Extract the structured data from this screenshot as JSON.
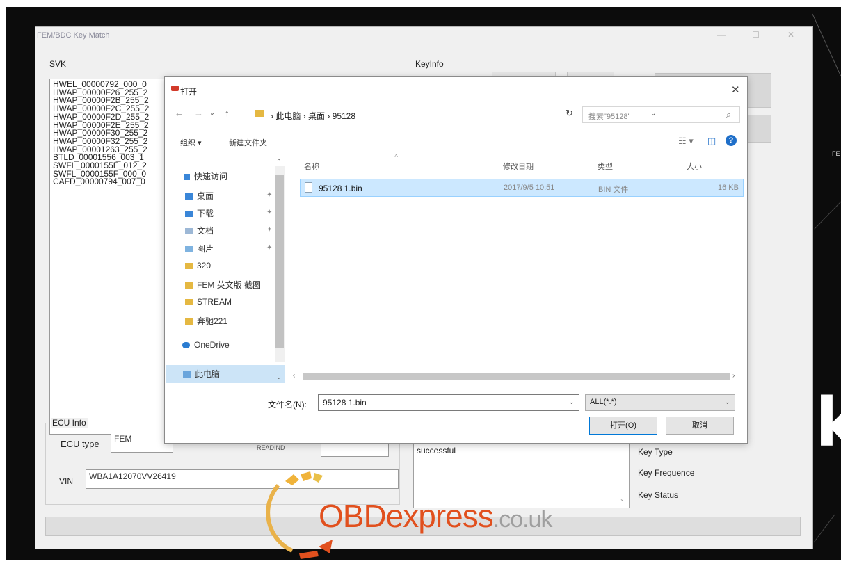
{
  "main_window": {
    "title": "FEM/BDC Key Match",
    "controls": {
      "minimize": "—",
      "maximize": "☐",
      "close": "✕"
    },
    "svk": {
      "label": "SVK",
      "items": [
        "HWEL_00000792_000_0",
        "HWAP_00000F26_255_2",
        "HWAP_00000F2B_255_2",
        "HWAP_00000F2C_255_2",
        "HWAP_00000F2D_255_2",
        "HWAP_00000F2E_255_2",
        "HWAP_00000F30_255_2",
        "HWAP_00000F32_255_2",
        "HWAP_00001263_255_2",
        "BTLD_00001556_003_1",
        "SWFL_0000155E_012_2",
        "SWFL_0000155F_000_0",
        "CAFD_00000794_007_0"
      ]
    },
    "keyinfo_label": "KeyInfo",
    "ecu_info": {
      "label": "ECU Info",
      "ecu_type_label": "ECU type",
      "ecu_type_value": "FEM",
      "partial_label": "READIND",
      "vin_label": "VIN",
      "vin_value": "WBA1A12070VV26419"
    },
    "result_text": "successful",
    "key_labels": [
      "Key Type",
      "Key Frequence",
      "Key Status"
    ]
  },
  "dialog": {
    "title": "打开",
    "close": "✕",
    "nav": {
      "back": "←",
      "forward": "→",
      "down": "⌄",
      "up": "↑"
    },
    "breadcrumb": "› 此电脑 › 桌面 › 95128",
    "refresh": "↻",
    "search_placeholder": "搜索\"95128\"",
    "search_icon": "⌕",
    "toolbar": {
      "organize": "组织 ▾",
      "new_folder": "新建文件夹",
      "view": "☷ ▾",
      "pane": "◫",
      "help": "?"
    },
    "nav_pane": {
      "quick_access": "快速访问",
      "items": [
        {
          "label": "桌面",
          "pinned": true,
          "icon": "desktop-icon"
        },
        {
          "label": "下载",
          "pinned": true,
          "icon": "download-icon"
        },
        {
          "label": "文档",
          "pinned": true,
          "icon": "documents-icon"
        },
        {
          "label": "图片",
          "pinned": true,
          "icon": "pictures-icon"
        },
        {
          "label": "320",
          "pinned": false,
          "icon": "folder-icon"
        },
        {
          "label": "FEM 英文版 截图",
          "pinned": false,
          "icon": "folder-icon"
        },
        {
          "label": "STREAM",
          "pinned": false,
          "icon": "folder-icon"
        },
        {
          "label": "奔驰221",
          "pinned": false,
          "icon": "folder-icon"
        }
      ],
      "onedrive": "OneDrive",
      "this_pc": "此电脑",
      "pin_glyph": "✦"
    },
    "columns": {
      "name": "名称",
      "date": "修改日期",
      "type": "类型",
      "size": "大小"
    },
    "files": [
      {
        "name": "95128 1.bin",
        "date": "2017/9/5 10:51",
        "type": "BIN 文件",
        "size": "16 KB"
      }
    ],
    "filename_label": "文件名(N):",
    "filename_value": "95128 1.bin",
    "filter_value": "ALL(*.*)",
    "open_button": "打开(O)",
    "cancel_button": "取消"
  },
  "background": {
    "side_label": "FE",
    "side_letter": "k"
  },
  "watermark": {
    "brand": "OBDexpress",
    "suffix": ".co.uk"
  },
  "colors": {
    "accent": "#0078d7",
    "selection": "#cce8ff",
    "watermark": "#e1501e"
  }
}
